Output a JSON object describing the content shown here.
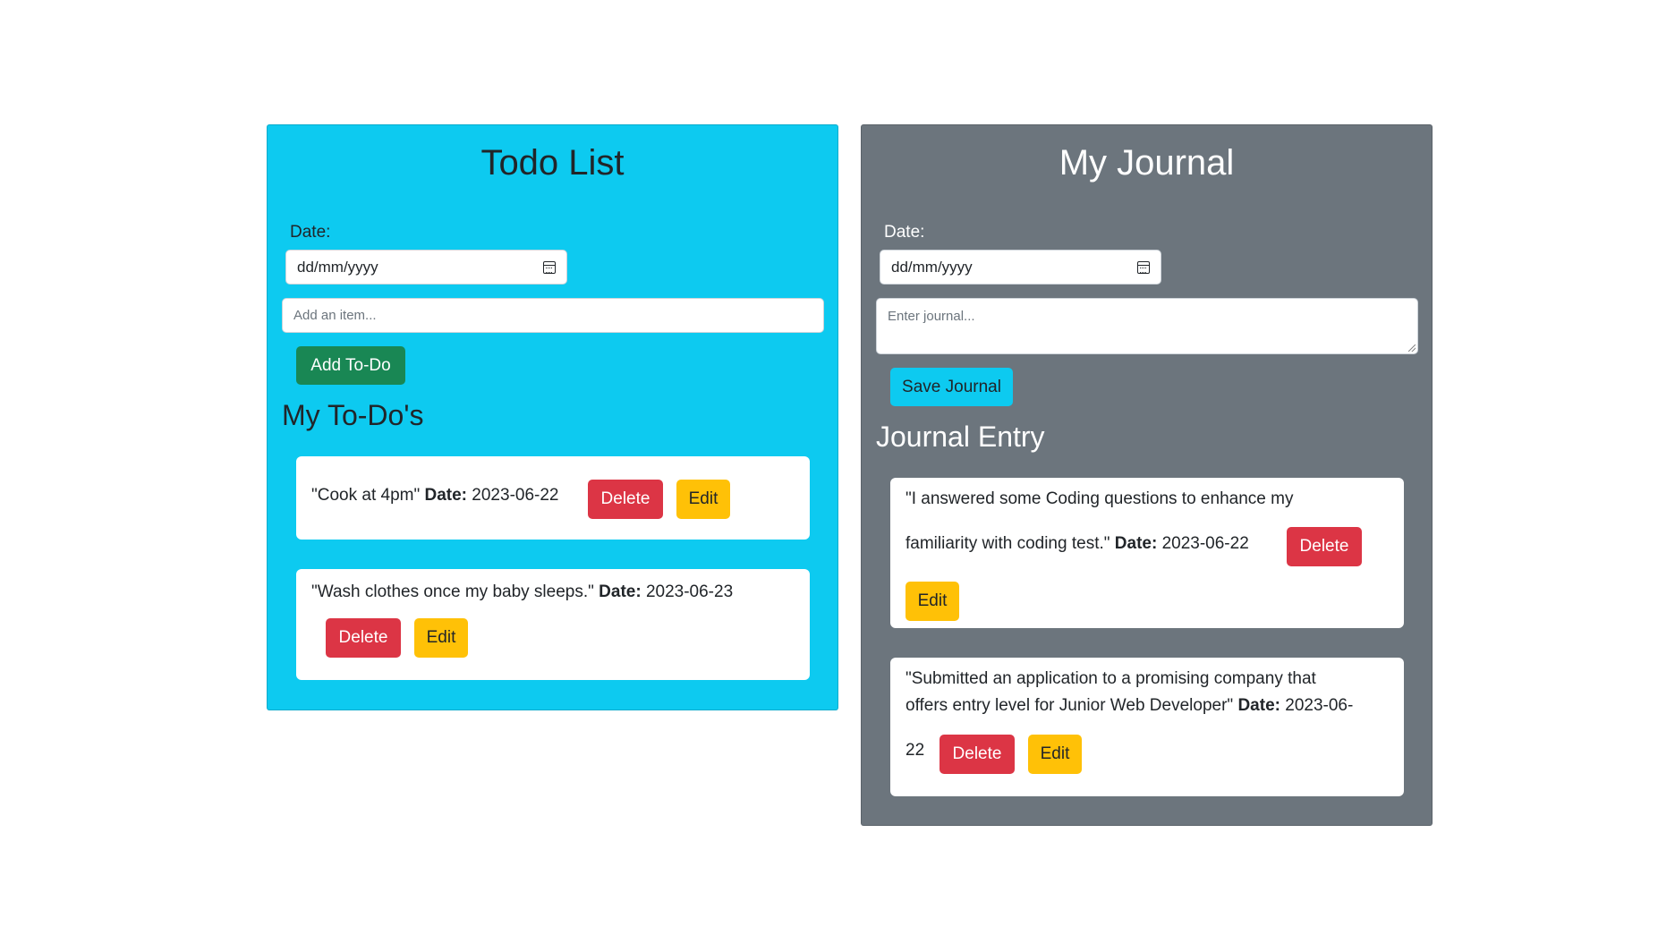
{
  "todo": {
    "title": "Todo List",
    "date_label": "Date:",
    "date_placeholder": "dd/mm/yyyy",
    "item_placeholder": "Add an item...",
    "add_button": "Add To-Do",
    "list_heading": "My To-Do's",
    "items": [
      {
        "text": "\"Cook at 4pm\"",
        "date_label": "Date:",
        "date": "2023-06-22",
        "delete_label": "Delete",
        "edit_label": "Edit"
      },
      {
        "text": "\"Wash clothes once my baby sleeps.\"",
        "date_label": "Date:",
        "date": "2023-06-23",
        "delete_label": "Delete",
        "edit_label": "Edit"
      }
    ]
  },
  "journal": {
    "title": "My Journal",
    "date_label": "Date:",
    "date_placeholder": "dd/mm/yyyy",
    "entry_placeholder": "Enter journal...",
    "save_button": "Save Journal",
    "list_heading": "Journal Entry",
    "entries": [
      {
        "text_line1": "\"I answered some Coding questions to enhance my",
        "text_line2": "familiarity with coding test.\"",
        "date_label": "Date:",
        "date": "2023-06-22",
        "delete_label": "Delete",
        "edit_label": "Edit"
      },
      {
        "text_line1": "\"Submitted an application to a promising company that",
        "text_line2": "offers entry level for Junior Web Developer\"",
        "date_label": "Date:",
        "date_part1": "2023-06-",
        "date_part2": "22",
        "delete_label": "Delete",
        "edit_label": "Edit"
      }
    ]
  },
  "colors": {
    "todo_panel": "#0dcaf0",
    "journal_panel": "#6c757d",
    "success": "#198754",
    "danger": "#dc3545",
    "warning": "#ffc107",
    "info": "#0dcaf0"
  }
}
